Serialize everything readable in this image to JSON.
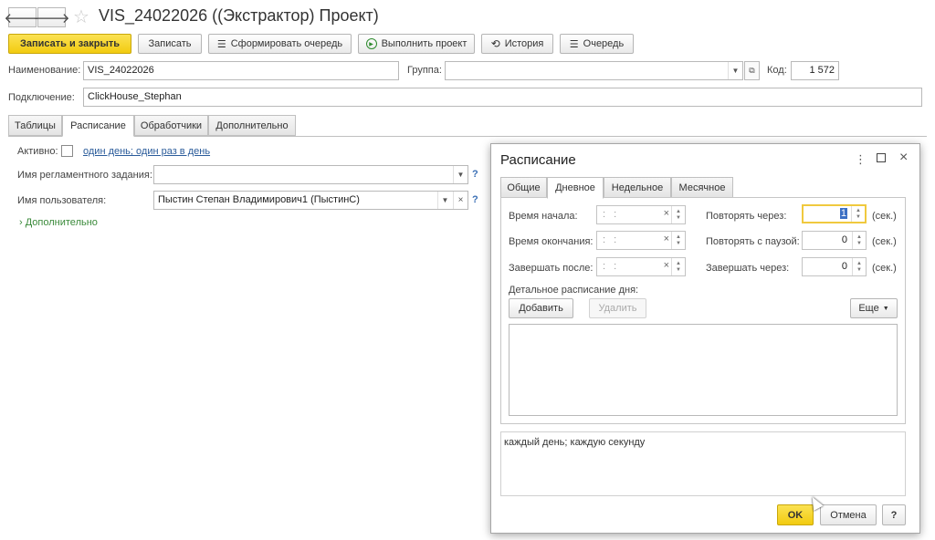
{
  "window": {
    "title": "VIS_24022026 ((Экстрактор) Проект)",
    "back_icon": "arrow-left-icon",
    "forward_icon": "arrow-right-icon",
    "favorite_icon": "star-icon"
  },
  "toolbar": {
    "save_close": "Записать и закрыть",
    "save": "Записать",
    "form_queue": "Сформировать очередь",
    "run_project": "Выполнить проект",
    "history": "История",
    "queue": "Очередь"
  },
  "form": {
    "name_label": "Наименование:",
    "name_value": "VIS_24022026",
    "group_label": "Группа:",
    "group_value": "",
    "code_label": "Код:",
    "code_value": "1 572",
    "connection_label": "Подключение:",
    "connection_value": "ClickHouse_Stephan"
  },
  "tabs": [
    {
      "label": "Таблицы"
    },
    {
      "label": "Расписание"
    },
    {
      "label": "Обработчики"
    },
    {
      "label": "Дополнительно"
    }
  ],
  "schedule_tab": {
    "active_label": "Активно:",
    "schedule_link": "один день; один раз в день",
    "job_name_label": "Имя регламентного задания:",
    "job_name_value": "",
    "user_label": "Имя пользователя:",
    "user_value": "Пыстин Степан Владимирович1 (ПыстинС)",
    "help": "?",
    "additional": "Дополнительно"
  },
  "dialog": {
    "title": "Расписание",
    "tabs": [
      {
        "label": "Общие"
      },
      {
        "label": "Дневное"
      },
      {
        "label": "Недельное"
      },
      {
        "label": "Месячное"
      }
    ],
    "start_time_label": "Время начала:",
    "end_time_label": "Время окончания:",
    "finish_after_label": "Завершать после:",
    "time_placeholder": ": :",
    "repeat_every_label": "Повторять через:",
    "repeat_every_value": "1",
    "repeat_pause_label": "Повторять с паузой:",
    "repeat_pause_value": "0",
    "finish_in_label": "Завершать через:",
    "finish_in_value": "0",
    "sec_unit": "(сек.)",
    "detail_label": "Детальное расписание дня:",
    "add_button": "Добавить",
    "delete_button": "Удалить",
    "more_button": "Еще",
    "summary": "каждый день; каждую секунду",
    "ok": "OK",
    "cancel": "Отмена",
    "help": "?"
  }
}
